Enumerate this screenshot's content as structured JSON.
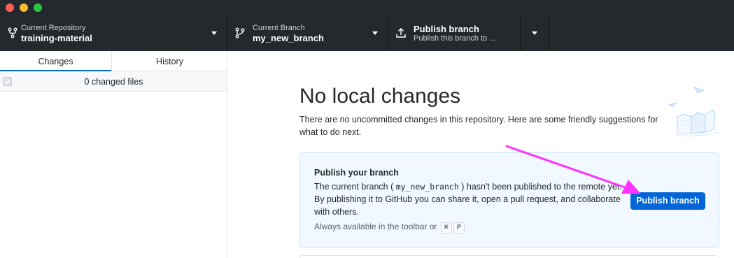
{
  "window": {
    "traffic_lights": [
      "close",
      "minimize",
      "maximize"
    ]
  },
  "toolbar": {
    "repository": {
      "label": "Current Repository",
      "value": "training-material",
      "icon": "repo-icon"
    },
    "branch": {
      "label": "Current Branch",
      "value": "my_new_branch",
      "icon": "branch-icon"
    },
    "publish": {
      "title": "Publish branch",
      "subtitle": "Publish this branch to ...",
      "icon": "upload-icon"
    }
  },
  "sidebar": {
    "tabs": [
      {
        "label": "Changes",
        "selected": true
      },
      {
        "label": "History",
        "selected": false
      }
    ],
    "changes_count": "0 changed files"
  },
  "main": {
    "title": "No local changes",
    "description": "There are no uncommitted changes in this repository. Here are some friendly suggestions for what to do next.",
    "card": {
      "title": "Publish your branch",
      "text_before": "The current branch (",
      "branch_name": "my_new_branch",
      "text_after": ") hasn't been published to the remote yet. By publishing it to GitHub you can share it, open a pull request, and collaborate with others.",
      "hint": "Always available in the toolbar or",
      "shortcut_cmd": "⌘",
      "shortcut_key": "P",
      "button_label": "Publish branch"
    }
  },
  "colors": {
    "toolbar_bg": "#24292e",
    "accent": "#0366d6",
    "card_bg": "#f1f8ff",
    "annotation_arrow": "#ff33ff"
  }
}
